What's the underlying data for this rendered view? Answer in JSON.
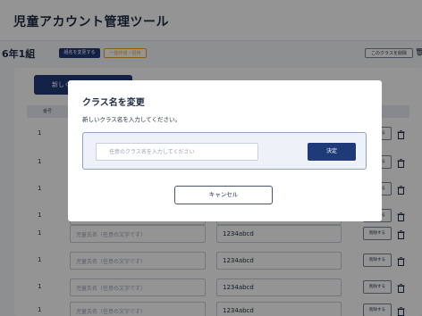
{
  "app": {
    "title": "児童アカウント管理ツール"
  },
  "classbar": {
    "class_name": "6年1組",
    "rename_label": "組名を変更する",
    "invite_label": "一括作成・招待",
    "delete_class_label": "このクラスを削除"
  },
  "table": {
    "new_button_label": "新しく作成",
    "headers": {
      "number": "番号"
    },
    "name_placeholder": "児童氏名（任意の文字です）",
    "delete_label": "削除する",
    "rows": [
      {
        "number": "1",
        "password": ""
      },
      {
        "number": "1",
        "password": ""
      },
      {
        "number": "1",
        "password": ""
      },
      {
        "number": "1",
        "password": ""
      },
      {
        "number": "1",
        "password": "1234abcd"
      },
      {
        "number": "1",
        "password": "1234abcd"
      },
      {
        "number": "1",
        "password": "1234abcd"
      },
      {
        "number": "1",
        "password": "1234abcd"
      }
    ]
  },
  "modal": {
    "title": "クラス名を変更",
    "subtitle": "新しいクラス名を入力してください。",
    "input_placeholder": "任意のクラス名を入力してください",
    "input_value": "",
    "decide_label": "決定",
    "cancel_label": "キャンセル"
  },
  "colors": {
    "primary": "#1f3a78",
    "accent_orange": "#f0a020",
    "overlay": "rgba(0,0,0,0.42)"
  },
  "icons": {
    "delete_row": "trash-icon"
  }
}
